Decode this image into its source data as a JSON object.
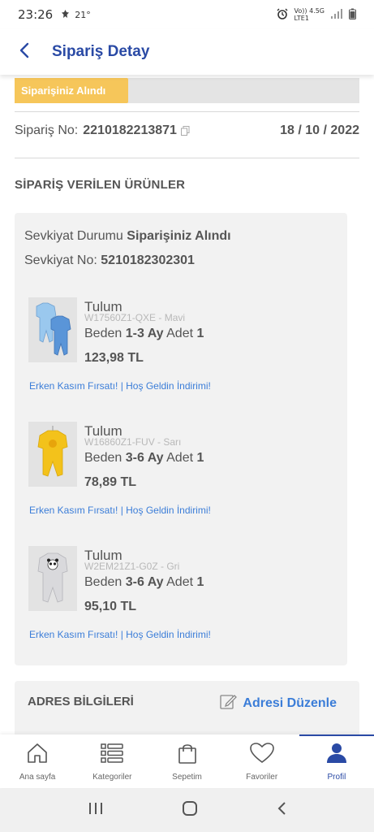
{
  "status_bar": {
    "time": "23:26",
    "temperature": "21°",
    "network_top": "Vo)) 4.5G",
    "network_bottom": "LTE1"
  },
  "header": {
    "title": "Sipariş Detay"
  },
  "order": {
    "status_label": "Siparişiniz Alındı",
    "status_progress": 0.33,
    "order_no_label": "Sipariş No:",
    "order_no": "2210182213871",
    "date": "18 / 10 / 2022"
  },
  "products_section": {
    "title": "SİPARİŞ VERİLEN ÜRÜNLER"
  },
  "shipment": {
    "status_label": "Sevkiyat Durumu",
    "status_value": "Siparişiniz Alındı",
    "number_label": "Sevkiyat No:",
    "number_value": "5210182302301"
  },
  "products": [
    {
      "name": "Tulum",
      "code": "W17560Z1-QXE - Mavi",
      "size_label": "Beden",
      "size_value": "1-3 Ay",
      "qty_label": "Adet",
      "qty_value": "1",
      "price": "123,98 TL",
      "promo": "Erken Kasım Fırsatı! | Hoş Geldin İndirimi!",
      "color": "#7fb6e6"
    },
    {
      "name": "Tulum",
      "code": "W16860Z1-FUV - Sarı",
      "size_label": "Beden",
      "size_value": "3-6 Ay",
      "qty_label": "Adet",
      "qty_value": "1",
      "price": "78,89 TL",
      "promo": "Erken Kasım Fırsatı! | Hoş Geldin İndirimi!",
      "color": "#f3c21b"
    },
    {
      "name": "Tulum",
      "code": "W2EM21Z1-G0Z - Gri",
      "size_label": "Beden",
      "size_value": "3-6 Ay",
      "qty_label": "Adet",
      "qty_value": "1",
      "price": "95,10 TL",
      "promo": "Erken Kasım Fırsatı! | Hoş Geldin İndirimi!",
      "color": "#d6d6d8"
    }
  ],
  "address": {
    "title": "ADRES BİLGİLERİ",
    "edit_label": "Adresi Düzenle"
  },
  "bottom_nav": {
    "items": [
      {
        "label": "Ana sayfa",
        "icon": "home-icon"
      },
      {
        "label": "Kategoriler",
        "icon": "categories-icon"
      },
      {
        "label": "Sepetim",
        "icon": "shopping-bag-icon"
      },
      {
        "label": "Favoriler",
        "icon": "heart-icon"
      },
      {
        "label": "Profil",
        "icon": "profile-icon",
        "active": true
      }
    ]
  },
  "colors": {
    "brand": "#2a4aa5",
    "progress": "#f6c65a",
    "link": "#3b7dd8"
  }
}
